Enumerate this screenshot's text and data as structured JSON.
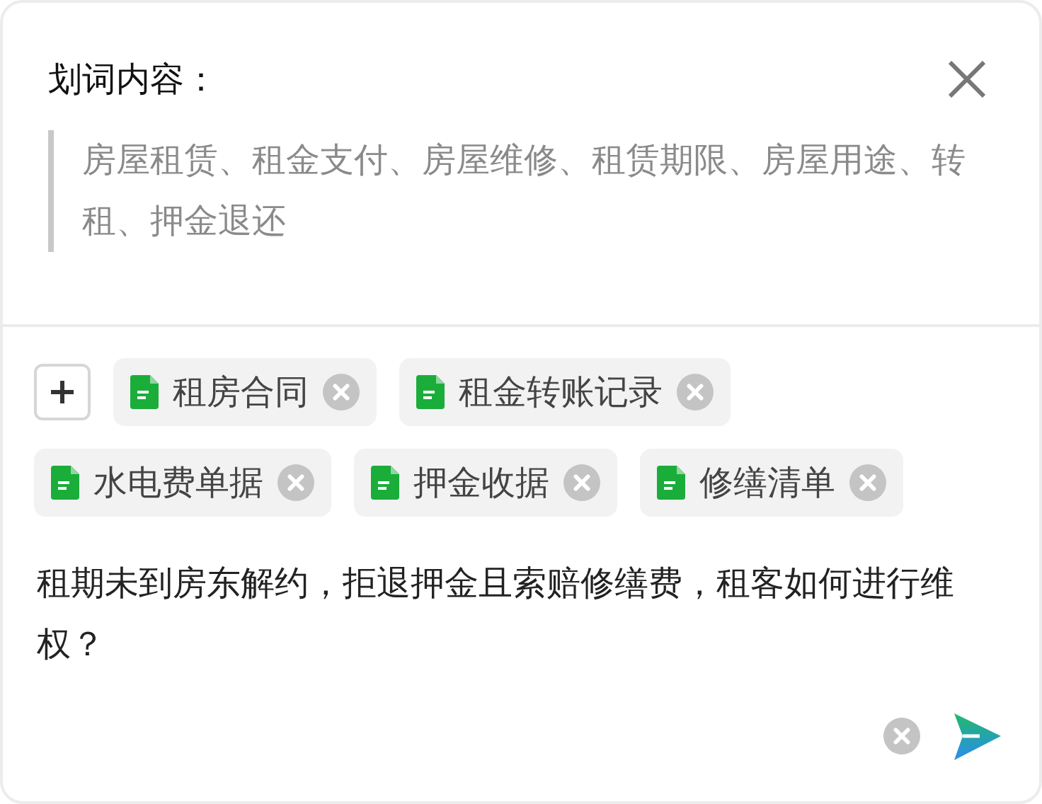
{
  "selection": {
    "title": "划词内容：",
    "quote": "房屋租赁、租金支付、房屋维修、租赁期限、房屋用途、转租、押金退还"
  },
  "attachments": [
    {
      "name": "租房合同"
    },
    {
      "name": "租金转账记录"
    },
    {
      "name": "水电费单据"
    },
    {
      "name": "押金收据"
    },
    {
      "name": "修缮清单"
    }
  ],
  "question": {
    "value": "租期未到房东解约，拒退押金且索赔修缮费，租客如何进行维权？"
  }
}
